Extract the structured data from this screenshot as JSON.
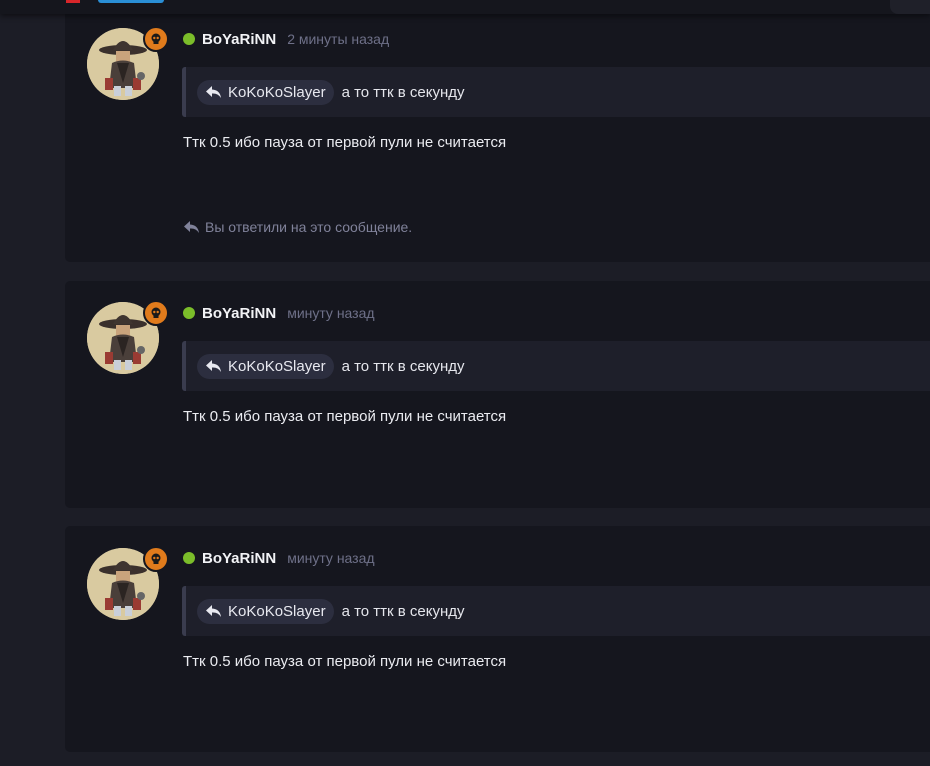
{
  "colors": {
    "background": "#1c1d26",
    "card": "#15161e",
    "online": "#7bbd2a",
    "badge": "#e07b1c",
    "quote_bg": "#1e1f2a",
    "mention_bg": "#2c2e3f"
  },
  "posts": [
    {
      "username": "BoYaRiNN",
      "time": "2 минуты назад",
      "quote": {
        "author": "KoKoKoSlayer",
        "text": "а то ттк в секунду",
        "icon": "reply-arrow-icon"
      },
      "message": "Ттк 0.5 ибо пауза от первой пули не считается",
      "replied_note": "Вы ответили на это сообщение.",
      "badge_icon": "skull-icon"
    },
    {
      "username": "BoYaRiNN",
      "time": "минуту назад",
      "quote": {
        "author": "KoKoKoSlayer",
        "text": "а то ттк в секунду",
        "icon": "reply-arrow-icon"
      },
      "message": "Ттк 0.5 ибо пауза от первой пули не считается",
      "badge_icon": "skull-icon"
    },
    {
      "username": "BoYaRiNN",
      "time": "минуту назад",
      "quote": {
        "author": "KoKoKoSlayer",
        "text": "а то ттк в секунду",
        "icon": "reply-arrow-icon"
      },
      "message": "Ттк 0.5 ибо пауза от первой пули не считается",
      "badge_icon": "skull-icon"
    }
  ]
}
